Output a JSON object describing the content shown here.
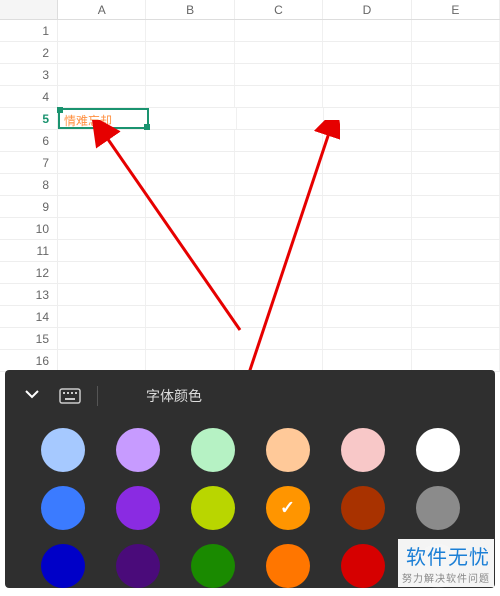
{
  "columns": [
    "A",
    "B",
    "C",
    "D",
    "E"
  ],
  "rows": [
    1,
    2,
    3,
    4,
    5,
    6,
    7,
    8,
    9,
    10,
    11,
    12,
    13,
    14,
    15,
    16
  ],
  "active_row": 5,
  "active_col": 0,
  "cell_value": "情难忘却",
  "panel": {
    "title": "字体颜色",
    "colors": [
      {
        "hex": "#a6c9ff",
        "sel": false
      },
      {
        "hex": "#c79bff",
        "sel": false
      },
      {
        "hex": "#b6f2c4",
        "sel": false
      },
      {
        "hex": "#ffc999",
        "sel": false
      },
      {
        "hex": "#f8c8c8",
        "sel": false
      },
      {
        "hex": "#ffffff",
        "sel": false
      },
      {
        "hex": "#3b7bff",
        "sel": false
      },
      {
        "hex": "#8a2be2",
        "sel": false
      },
      {
        "hex": "#b9d600",
        "sel": false
      },
      {
        "hex": "#ff9500",
        "sel": true
      },
      {
        "hex": "#a83200",
        "sel": false
      },
      {
        "hex": "#8b8b8b",
        "sel": false
      },
      {
        "hex": "#0000c8",
        "sel": false
      },
      {
        "hex": "#4a0b7a",
        "sel": false
      },
      {
        "hex": "#1a8a00",
        "sel": false
      },
      {
        "hex": "#ff7600",
        "sel": false
      },
      {
        "hex": "#d60000",
        "sel": false
      },
      {
        "hex": "#4a4a4a",
        "sel": false
      }
    ]
  },
  "watermark": {
    "main": "软件无忧",
    "sub": "努力解决软件问题"
  }
}
